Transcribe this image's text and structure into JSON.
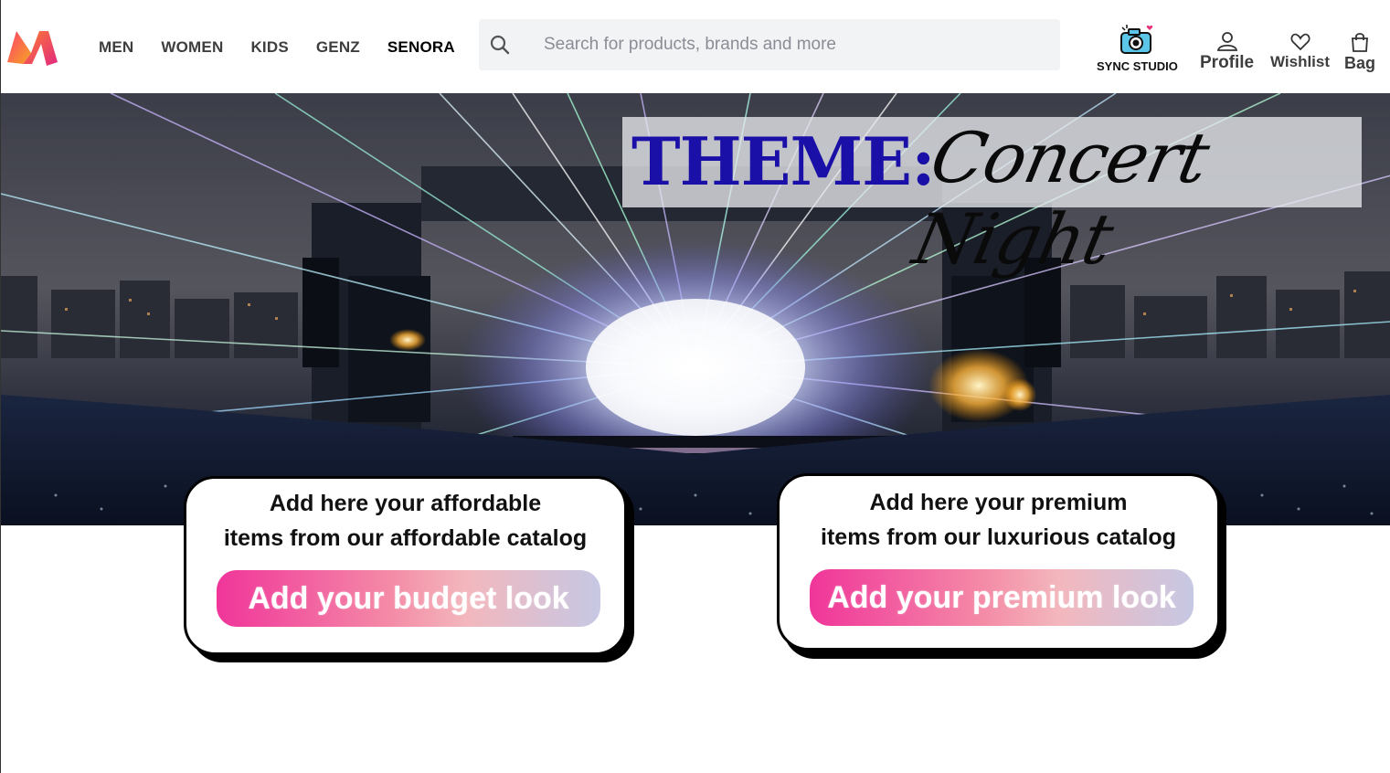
{
  "brand": {
    "name": "Myntra",
    "logo_icon": "myntra-m-logo"
  },
  "nav": {
    "items": [
      {
        "label": "MEN"
      },
      {
        "label": "WOMEN"
      },
      {
        "label": "KIDS"
      },
      {
        "label": "GENZ"
      },
      {
        "label": "SENORA"
      }
    ]
  },
  "search": {
    "placeholder": "Search for products, brands and more",
    "icon": "search-icon"
  },
  "actions": {
    "sync_studio": {
      "label": "SYNC STUDIO",
      "icon": "camera-heart-icon"
    },
    "profile": {
      "label": "Profile",
      "icon": "user-icon"
    },
    "wishlist": {
      "label": "Wishlist",
      "icon": "heart-icon"
    },
    "bag": {
      "label": "Bag",
      "icon": "bag-icon"
    }
  },
  "hero": {
    "theme_label": "THEME:",
    "theme_name": "Concert Night",
    "image": "concert-stage-lasers"
  },
  "cards": {
    "budget": {
      "line1": "Add here your affordable",
      "line2": "items from our affordable catalog",
      "button": "Add your budget look"
    },
    "premium": {
      "line1": "Add here your premium",
      "line2": "items from our luxurious catalog",
      "button": "Add your premium look"
    }
  },
  "colors": {
    "theme_blue": "#1a0fa6",
    "cta_pink": "#f0359a",
    "cta_lavender": "#c6c8e4",
    "nav_text": "#3e3e3e"
  }
}
